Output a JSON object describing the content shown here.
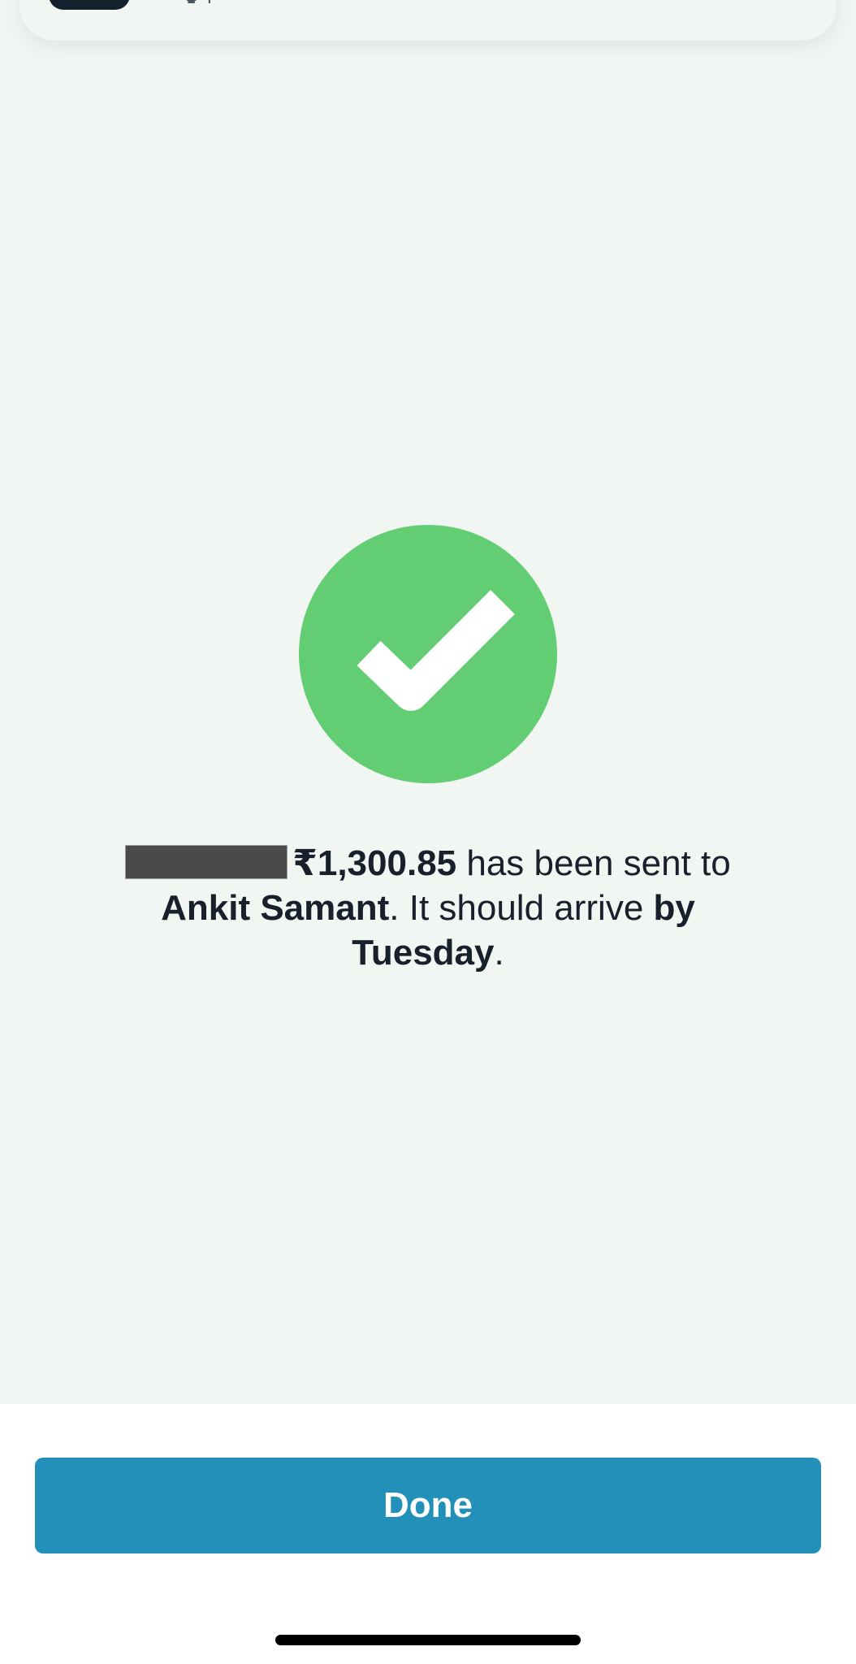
{
  "top_card": {
    "partial_text": "★ |"
  },
  "success_icon": {
    "name": "checkmark-icon",
    "color": "#63cd73"
  },
  "message": {
    "amount": "₹1,300.85",
    "text_sent": " has been sent to ",
    "recipient": "Ankit Samant",
    "text_arrive": ". It should arrive ",
    "arrival": "by Tuesday",
    "end": "."
  },
  "footer": {
    "done_label": "Done"
  },
  "colors": {
    "background": "#f1f6f3",
    "accent": "#2290b8",
    "success": "#63cd73"
  }
}
